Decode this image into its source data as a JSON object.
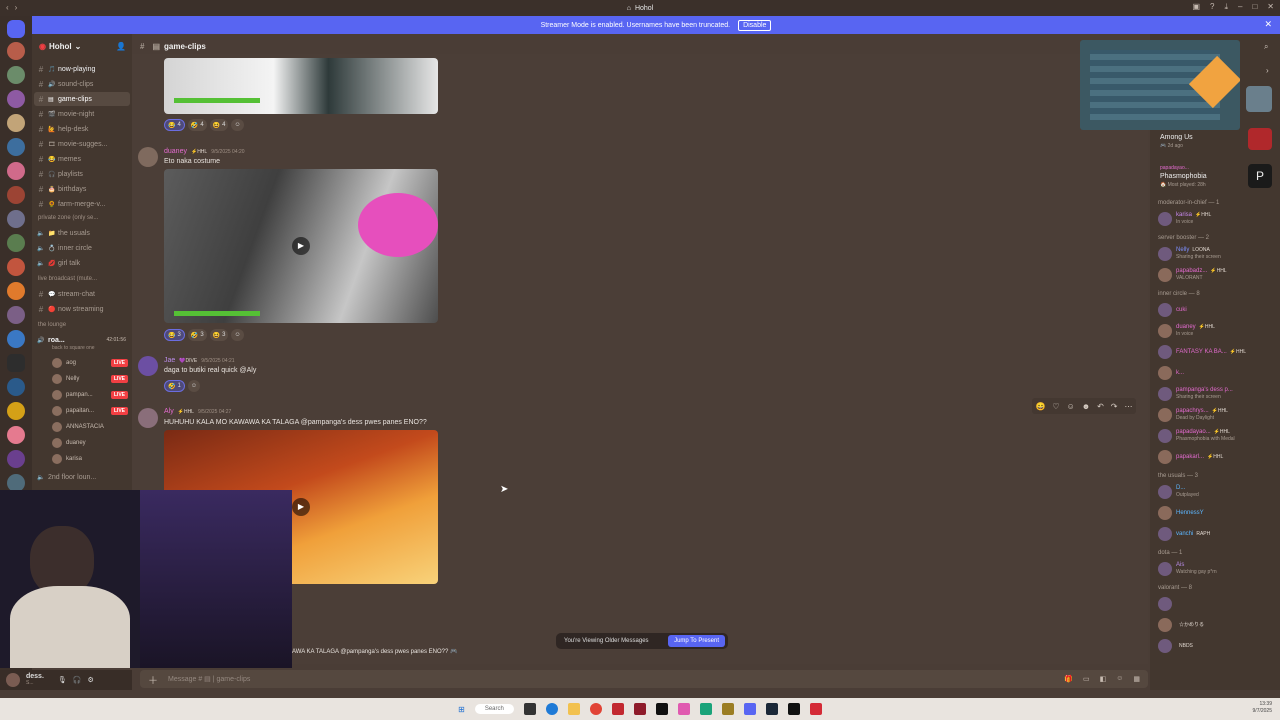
{
  "window": {
    "title": "Hohol"
  },
  "banner": {
    "text": "Streamer Mode is enabled. Usernames have been truncated.",
    "button": "Disable"
  },
  "guild": {
    "name": "Hohol"
  },
  "channels": [
    {
      "name": "now-playing",
      "icon": "🎵",
      "state": "unread"
    },
    {
      "name": "sound-clips",
      "icon": "🔊",
      "state": ""
    },
    {
      "name": "game-clips",
      "icon": "▤",
      "state": "active"
    },
    {
      "name": "movie-night",
      "icon": "🎬",
      "state": ""
    },
    {
      "name": "help-desk",
      "icon": "🙋",
      "state": ""
    },
    {
      "name": "movie-sugges...",
      "icon": "🎞",
      "state": ""
    },
    {
      "name": "memes",
      "icon": "😂",
      "state": ""
    },
    {
      "name": "playlists",
      "icon": "🎧",
      "state": ""
    },
    {
      "name": "birthdays",
      "icon": "🎂",
      "state": ""
    },
    {
      "name": "farm-merge-v...",
      "icon": "🌻",
      "state": ""
    }
  ],
  "categories": {
    "private": "private zone (only se...",
    "live": "live broadcast (mute...",
    "lounge": "the lounge"
  },
  "private_channels": [
    {
      "name": "the usuals",
      "icon": "📁"
    },
    {
      "name": "inner circle",
      "icon": "💍"
    },
    {
      "name": "girl talk",
      "icon": "💋"
    }
  ],
  "live_channels": [
    {
      "name": "stream-chat",
      "icon": "💬"
    },
    {
      "name": "now streaming",
      "icon": "🔴"
    }
  ],
  "voice": {
    "channel": "roa...",
    "timer": "42:01:56",
    "status": "back to square one",
    "users": [
      {
        "name": "aog",
        "live": "LIVE"
      },
      {
        "name": "Nelly",
        "live": "LIVE"
      },
      {
        "name": "pampan...",
        "live": "LIVE"
      },
      {
        "name": "papaitan...",
        "live": "LIVE"
      },
      {
        "name": "ANNASTACIA",
        "live": ""
      },
      {
        "name": "duaney",
        "live": ""
      },
      {
        "name": "karisa",
        "live": ""
      }
    ],
    "next_channel": "2nd floor loun..."
  },
  "chat": {
    "channel": "game-clips",
    "messages": [
      {
        "author": "duaney",
        "tag": "⚡HHL",
        "time": "9/5/2025 04:20",
        "text": "Eto naka costume",
        "color": "#e36bcf"
      },
      {
        "author": "Jae",
        "tag": "💜DIVE",
        "time": "9/5/2025 04:21",
        "text": "daga to butiki real quick @Aly",
        "color": "#b98ce8"
      },
      {
        "author": "Aly",
        "tag": "⚡HHL",
        "time": "9/5/2025 04:27",
        "text": "HUHUHU KALA MO KAWAWA KA TALAGA @pampanga's dess pwes panes ENO??",
        "color": "#e36bcf"
      }
    ],
    "reactions_top": [
      {
        "emoji": "😂",
        "count": "4"
      },
      {
        "emoji": "🤣",
        "count": "4"
      },
      {
        "emoji": "😆",
        "count": "4"
      }
    ],
    "reactions_mid": [
      {
        "emoji": "😂",
        "count": "3"
      },
      {
        "emoji": "🤣",
        "count": "3"
      },
      {
        "emoji": "😆",
        "count": "3"
      }
    ],
    "reactions_jae": [
      {
        "emoji": "🤣",
        "count": "1"
      }
    ],
    "tail_text": "AWA KA TALAGA @pampanga's dess pwes panes ENO?? 🎮",
    "older_text": "You're Viewing Older Messages",
    "jump_label": "Jump To Present",
    "composer_placeholder": "Message # ▤ | game-clips"
  },
  "user": {
    "name": "dess.",
    "status": "S..."
  },
  "members": {
    "activities": [
      {
        "title": "Among Us",
        "sub": "🎮 2d ago"
      },
      {
        "title": "Phasmophobia",
        "sub": "🏠 Most played: 28h",
        "pre": "papadayao..."
      }
    ],
    "groups": [
      {
        "title": "moderator-in-chief — 1",
        "items": [
          {
            "name": "karisa",
            "tag": "⚡HHL",
            "sub": "In voice",
            "color": "#c889f0"
          }
        ]
      },
      {
        "title": "server booster — 2",
        "items": [
          {
            "name": "Nelly",
            "tag": "LOONA",
            "sub": "Sharing their screen",
            "color": "#7d8fff"
          },
          {
            "name": "papabadz...",
            "tag": "⚡HHL",
            "sub": "VALORANT",
            "color": "#e36bcf"
          }
        ]
      },
      {
        "title": "inner circle — 8",
        "items": [
          {
            "name": "cuki",
            "tag": "",
            "sub": "",
            "color": "#e36bcf"
          },
          {
            "name": "duaney",
            "tag": "⚡HHL",
            "sub": "In voice",
            "color": "#e36bcf"
          },
          {
            "name": "FANTASY KA BA...",
            "tag": "⚡HHL",
            "sub": "",
            "color": "#e36bcf"
          },
          {
            "name": "k...",
            "tag": "",
            "sub": "",
            "color": "#e36bcf"
          },
          {
            "name": "pampanga's dess p...",
            "tag": "",
            "sub": "Sharing their screen",
            "color": "#e36bcf"
          },
          {
            "name": "papachrys...",
            "tag": "⚡HHL",
            "sub": "Dead by Daylight",
            "color": "#e36bcf"
          },
          {
            "name": "papadayao...",
            "tag": "⚡HHL",
            "sub": "Phasmophobia with Medal",
            "color": "#e36bcf"
          },
          {
            "name": "papakarl...",
            "tag": "⚡HHL",
            "sub": "",
            "color": "#e36bcf"
          }
        ]
      },
      {
        "title": "the usuals — 3",
        "items": [
          {
            "name": "D...",
            "tag": "",
            "sub": "Outplayed",
            "color": "#5cb6ff"
          },
          {
            "name": "HennessY",
            "tag": "",
            "sub": "",
            "color": "#5cb6ff"
          },
          {
            "name": "vanchi",
            "tag": "RAPH",
            "sub": "",
            "color": "#5cb6ff"
          }
        ]
      },
      {
        "title": "dota — 1",
        "items": [
          {
            "name": "Ais",
            "tag": "",
            "sub": "Watching gay p*rn",
            "color": "#b98ce8"
          }
        ]
      },
      {
        "title": "valorant — 8",
        "items": [
          {
            "name": "",
            "tag": "",
            "sub": "",
            "color": "#f23f43"
          },
          {
            "name": "",
            "tag": "☆かめりる",
            "sub": "",
            "color": "#f23f43"
          },
          {
            "name": "",
            "tag": "NBDS",
            "sub": "",
            "color": "#f23f43"
          }
        ]
      }
    ]
  },
  "taskbar": {
    "search": "Search",
    "time": "13:39",
    "date": "9/7/2025"
  },
  "colors": {
    "accent": "#5865f2",
    "live": "#f23f43",
    "bg": "#4b3e37"
  }
}
